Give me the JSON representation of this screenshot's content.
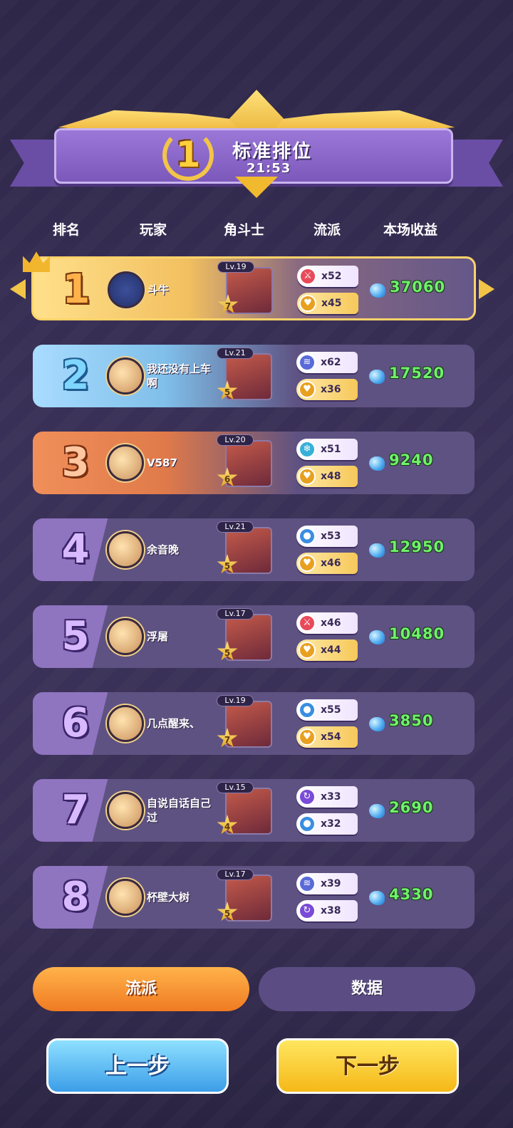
{
  "header": {
    "rank": "1",
    "mode": "标准排位",
    "time": "21:53"
  },
  "columns": [
    "排名",
    "玩家",
    "角斗士",
    "流派",
    "本场收益"
  ],
  "rows": [
    {
      "rank": "1",
      "player": "斗牛",
      "level": "Lv.19",
      "stars": "7",
      "tag1": {
        "icon": "sword-icon",
        "color": "#e84a5a",
        "count": "x52"
      },
      "tag2": {
        "icon": "heart-icon",
        "color": "#e8a020",
        "count": "x45"
      },
      "earnings": "37060"
    },
    {
      "rank": "2",
      "player": "我还没有上车啊",
      "level": "Lv.21",
      "stars": "5",
      "tag1": {
        "icon": "wind-icon",
        "color": "#5a6ad8",
        "count": "x62"
      },
      "tag2": {
        "icon": "heart-icon",
        "color": "#e8a020",
        "count": "x36"
      },
      "earnings": "17520"
    },
    {
      "rank": "3",
      "player": "V587",
      "level": "Lv.20",
      "stars": "6",
      "tag1": {
        "icon": "snowflake-icon",
        "color": "#38b0d8",
        "count": "x51"
      },
      "tag2": {
        "icon": "heart-icon",
        "color": "#e8a020",
        "count": "x48"
      },
      "earnings": "9240"
    },
    {
      "rank": "4",
      "player": "余音晚",
      "level": "Lv.21",
      "stars": "5",
      "tag1": {
        "icon": "water-drop-icon",
        "color": "#3a8ee0",
        "count": "x53"
      },
      "tag2": {
        "icon": "heart-icon",
        "color": "#e8a020",
        "count": "x46"
      },
      "earnings": "12950"
    },
    {
      "rank": "5",
      "player": "浮屠",
      "level": "Lv.17",
      "stars": "5",
      "tag1": {
        "icon": "sword-icon",
        "color": "#e84a5a",
        "count": "x46"
      },
      "tag2": {
        "icon": "heart-icon",
        "color": "#e8a020",
        "count": "x44"
      },
      "earnings": "10480"
    },
    {
      "rank": "6",
      "player": "几点醒来、",
      "level": "Lv.19",
      "stars": "7",
      "tag1": {
        "icon": "water-drop-icon",
        "color": "#3a8ee0",
        "count": "x55"
      },
      "tag2": {
        "icon": "heart-icon",
        "color": "#e8a020",
        "count": "x54"
      },
      "earnings": "3850"
    },
    {
      "rank": "7",
      "player": "自说自话自己过",
      "level": "Lv.15",
      "stars": "4",
      "tag1": {
        "icon": "cycle-icon",
        "color": "#7a4ad8",
        "count": "x33"
      },
      "tag2": {
        "icon": "water-drop-icon",
        "color": "#3a8ee0",
        "count": "x32"
      },
      "earnings": "2690"
    },
    {
      "rank": "8",
      "player": "杯壁大树",
      "level": "Lv.17",
      "stars": "5",
      "tag1": {
        "icon": "wind-icon",
        "color": "#5a6ad8",
        "count": "x39"
      },
      "tag2": {
        "icon": "cycle-icon",
        "color": "#7a4ad8",
        "count": "x38"
      },
      "earnings": "4330"
    }
  ],
  "tabs": {
    "active": "流派",
    "inactive": "数据"
  },
  "nav": {
    "prev": "上一步",
    "next": "下一步"
  }
}
